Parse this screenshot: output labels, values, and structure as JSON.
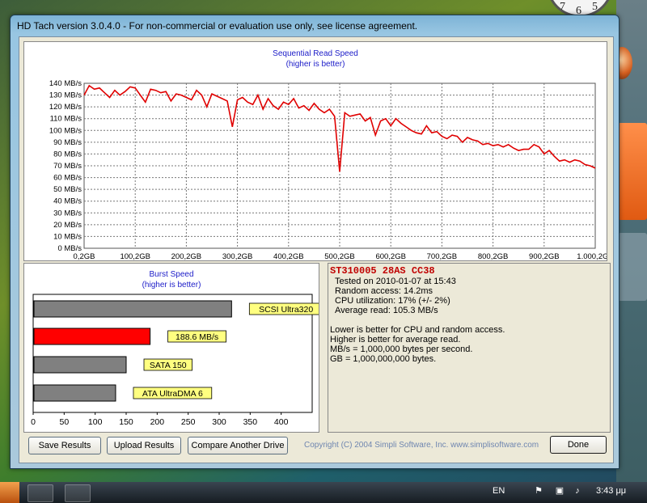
{
  "window": {
    "title": "HD Tach version 3.0.4.0  - For non-commercial or evaluation use only, see license agreement."
  },
  "chart_data": {
    "type": "line",
    "title": "Sequential Read Speed",
    "subtitle": "(higher is better)",
    "xlabel": "",
    "ylabel": "",
    "xlim": [
      0,
      1000
    ],
    "ylim": [
      0,
      140
    ],
    "x_ticks": [
      "0,2GB",
      "100,2GB",
      "200,2GB",
      "300,2GB",
      "400,2GB",
      "500,2GB",
      "600,2GB",
      "700,2GB",
      "800,2GB",
      "900,2GB",
      "1.000,2GB"
    ],
    "y_ticks": [
      "0 MB/s",
      "10 MB/s",
      "20 MB/s",
      "30 MB/s",
      "40 MB/s",
      "50 MB/s",
      "60 MB/s",
      "70 MB/s",
      "80 MB/s",
      "90 MB/s",
      "100 MB/s",
      "110 MB/s",
      "120 MB/s",
      "130 MB/s",
      "140 MB/s"
    ],
    "grid": true,
    "color": "#e00000",
    "series": [
      {
        "x": [
          0,
          10,
          20,
          30,
          40,
          50,
          60,
          70,
          80,
          90,
          100,
          110,
          120,
          130,
          140,
          150,
          160,
          170,
          180,
          190,
          200,
          210,
          220,
          230,
          240,
          250,
          260,
          270,
          280,
          290,
          300,
          310,
          320,
          330,
          340,
          350,
          360,
          370,
          380,
          390,
          400,
          410,
          420,
          430,
          440,
          450,
          460,
          470,
          480,
          490,
          500,
          510,
          520,
          530,
          540,
          550,
          560,
          570,
          580,
          590,
          600,
          610,
          620,
          630,
          640,
          650,
          660,
          670,
          680,
          690,
          700,
          710,
          720,
          730,
          740,
          750,
          760,
          770,
          780,
          790,
          800,
          810,
          820,
          830,
          840,
          850,
          860,
          870,
          880,
          890,
          900,
          910,
          920,
          930,
          940,
          950,
          960,
          970,
          980,
          990,
          1000
        ],
        "values": [
          130,
          138,
          135,
          136,
          132,
          128,
          134,
          130,
          133,
          137,
          136,
          130,
          124,
          135,
          134,
          132,
          133,
          125,
          131,
          130,
          128,
          126,
          134,
          130,
          120,
          131,
          129,
          127,
          125,
          103,
          126,
          128,
          124,
          122,
          130,
          118,
          127,
          121,
          118,
          124,
          122,
          127,
          119,
          121,
          117,
          123,
          118,
          115,
          118,
          112,
          65,
          115,
          112,
          113,
          114,
          108,
          111,
          96,
          108,
          110,
          104,
          110,
          106,
          103,
          100,
          98,
          97,
          104,
          98,
          99,
          95,
          93,
          96,
          95,
          90,
          94,
          92,
          91,
          88,
          89,
          87,
          88,
          86,
          88,
          85,
          83,
          84,
          84,
          88,
          86,
          80,
          83,
          78,
          74,
          75,
          73,
          75,
          74,
          71,
          70,
          68
        ]
      }
    ]
  },
  "burst_chart": {
    "type": "bar",
    "title": "Burst Speed",
    "subtitle": "(higher is better)",
    "xlim": [
      0,
      450
    ],
    "x_ticks": [
      "0",
      "50",
      "100",
      "150",
      "200",
      "250",
      "300",
      "350",
      "400"
    ],
    "bars": [
      {
        "label": "SCSI Ultra320",
        "value": 320,
        "color": "#808080"
      },
      {
        "label": "188.6 MB/s",
        "value": 188.6,
        "color": "#ff0000"
      },
      {
        "label": "SATA 150",
        "value": 150,
        "color": "#808080"
      },
      {
        "label": "ATA UltraDMA 6",
        "value": 133,
        "color": "#808080"
      }
    ]
  },
  "info": {
    "drive": "ST310005 28AS CC38",
    "tested": "Tested on 2010-01-07 at 15:43",
    "random_access": "Random access: 14.2ms",
    "cpu": "CPU utilization: 17% (+/- 2%)",
    "average_read": "Average read: 105.3 MB/s",
    "note1": "Lower is better for CPU and random access.",
    "note2": "Higher is better for average read.",
    "note3": "MB/s = 1,000,000 bytes per second.",
    "note4": "GB = 1,000,000,000 bytes."
  },
  "buttons": {
    "save": "Save Results",
    "upload": "Upload Results",
    "compare": "Compare Another Drive",
    "done": "Done"
  },
  "copyright": "Copyright (C) 2004 Simpli Software, Inc. www.simplisoftware.com",
  "taskbar": {
    "language": "EN",
    "time": "3:43 μμ"
  },
  "desktop": {
    "clock_digits": [
      "7",
      "6",
      "5"
    ]
  }
}
